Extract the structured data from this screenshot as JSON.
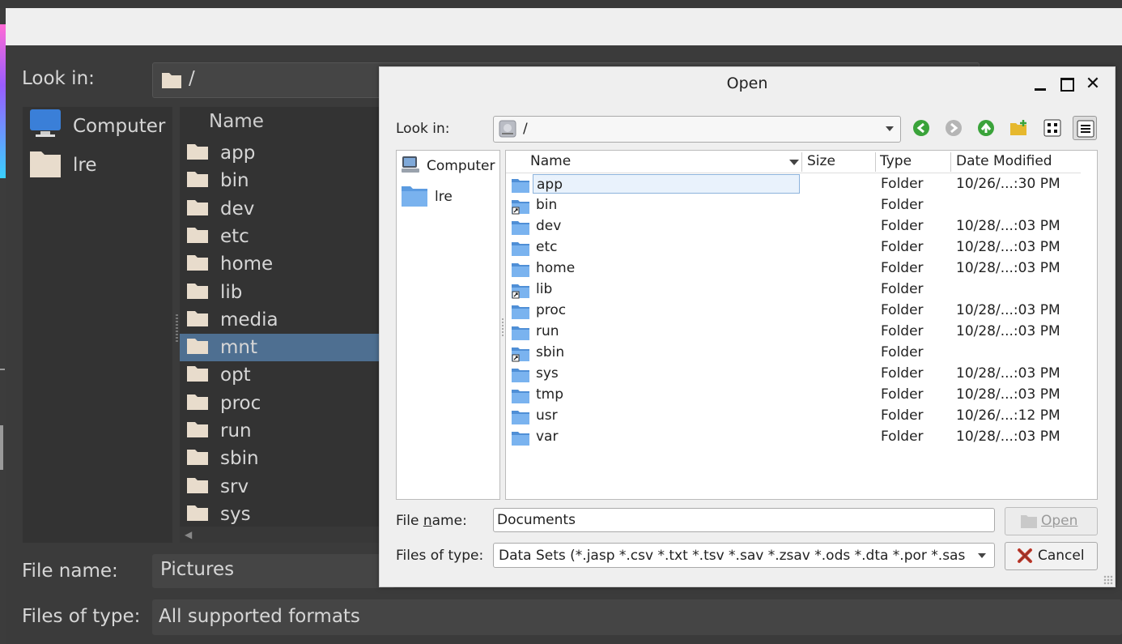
{
  "background_dialog": {
    "look_in_label": "Look in:",
    "look_in_path": "/",
    "sidebar": [
      {
        "label": "Computer",
        "icon": "monitor-icon"
      },
      {
        "label": "lre",
        "icon": "folder-icon"
      }
    ],
    "list_header": "Name",
    "items": [
      "app",
      "bin",
      "dev",
      "etc",
      "home",
      "lib",
      "media",
      "mnt",
      "opt",
      "proc",
      "run",
      "sbin",
      "srv",
      "sys"
    ],
    "selected_item": "mnt",
    "file_name_label": "File name:",
    "file_name_value": "Pictures",
    "files_of_type_label": "Files of type:",
    "files_of_type_value": "All supported formats"
  },
  "dialog": {
    "title": "Open",
    "look_in_label": "Look in:",
    "look_in_path": "/",
    "toolbar": {
      "back": "back-arrow-icon",
      "forward": "forward-arrow-icon",
      "up": "up-arrow-icon",
      "new_folder": "new-folder-icon",
      "list_view": "icon-view-icon",
      "detail_view": "detail-view-icon"
    },
    "sidebar": [
      {
        "label": "Computer",
        "icon": "computer-icon"
      },
      {
        "label": "lre",
        "icon": "folder-icon"
      }
    ],
    "columns": {
      "name": "Name",
      "size": "Size",
      "type": "Type",
      "date": "Date Modified"
    },
    "files": [
      {
        "name": "app",
        "type": "Folder",
        "date": "10/26/...:30 PM",
        "link": false,
        "selected": true
      },
      {
        "name": "bin",
        "type": "Folder",
        "date": "",
        "link": true
      },
      {
        "name": "dev",
        "type": "Folder",
        "date": "10/28/...:03 PM",
        "link": false
      },
      {
        "name": "etc",
        "type": "Folder",
        "date": "10/28/...:03 PM",
        "link": false
      },
      {
        "name": "home",
        "type": "Folder",
        "date": "10/28/...:03 PM",
        "link": false
      },
      {
        "name": "lib",
        "type": "Folder",
        "date": "",
        "link": true
      },
      {
        "name": "proc",
        "type": "Folder",
        "date": "10/28/...:03 PM",
        "link": false
      },
      {
        "name": "run",
        "type": "Folder",
        "date": "10/28/...:03 PM",
        "link": false
      },
      {
        "name": "sbin",
        "type": "Folder",
        "date": "",
        "link": true
      },
      {
        "name": "sys",
        "type": "Folder",
        "date": "10/28/...:03 PM",
        "link": false
      },
      {
        "name": "tmp",
        "type": "Folder",
        "date": "10/28/...:03 PM",
        "link": false
      },
      {
        "name": "usr",
        "type": "Folder",
        "date": "10/26/...:12 PM",
        "link": false
      },
      {
        "name": "var",
        "type": "Folder",
        "date": "10/28/...:03 PM",
        "link": false
      }
    ],
    "file_name_label_pre": "File ",
    "file_name_label_key": "n",
    "file_name_label_post": "ame:",
    "file_name_value": "Documents",
    "files_of_type_label": "Files of type:",
    "files_of_type_value": "Data Sets (*.jasp *.csv *.txt *.tsv *.sav *.zsav *.ods *.dta *.por *.sas",
    "open_button": "Open",
    "cancel_button": "Cancel"
  },
  "colors": {
    "selection_dark": "#4e6f91",
    "selection_light": "#e9f2fc",
    "folder_blue": "#4f8fd6",
    "nav_green": "#3aa33a"
  }
}
